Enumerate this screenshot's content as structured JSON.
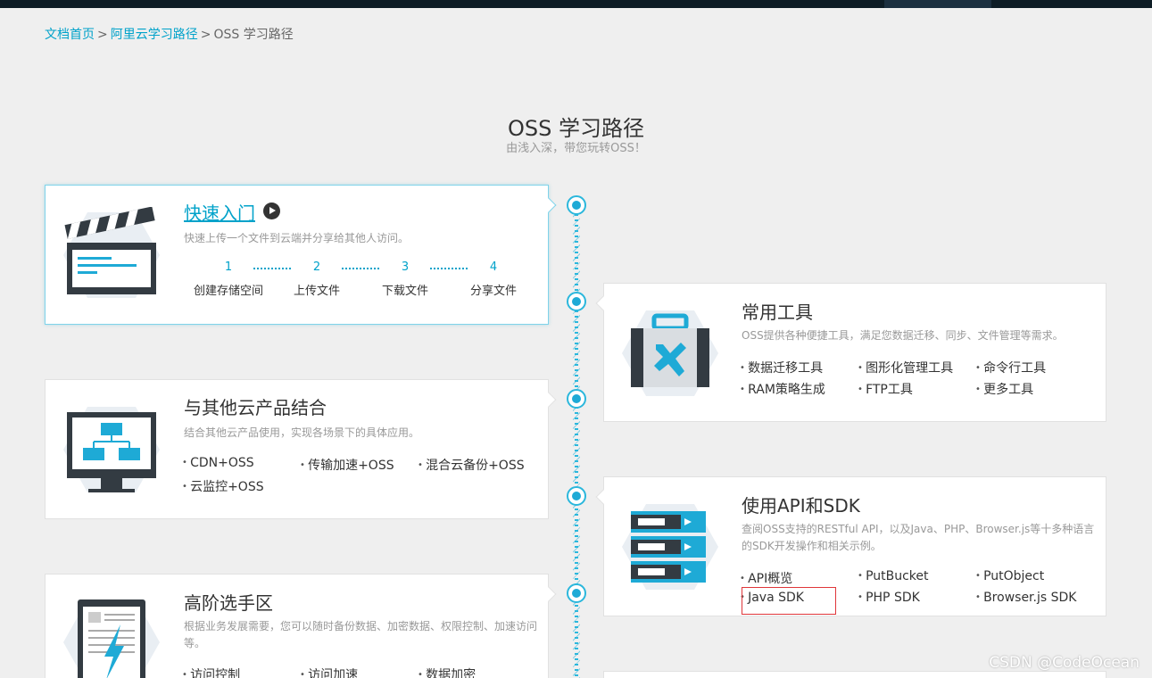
{
  "breadcrumb": {
    "home": "文档首页",
    "sep": ">",
    "path": "阿里云学习路径",
    "current": "OSS 学习路径"
  },
  "header": {
    "title": "OSS 学习路径",
    "subtitle": "由浅入深，带您玩转OSS！"
  },
  "cards": {
    "quickstart": {
      "title": "快速入门",
      "desc": "快速上传一个文件到云端并分享给其他人访问。",
      "steps": [
        {
          "num": "1",
          "label": "创建存储空间"
        },
        {
          "num": "2",
          "label": "上传文件"
        },
        {
          "num": "3",
          "label": "下载文件"
        },
        {
          "num": "4",
          "label": "分享文件"
        }
      ],
      "icon": "clapperboard-icon"
    },
    "tools": {
      "title": "常用工具",
      "desc": "OSS提供各种便捷工具，满足您数据迁移、同步、文件管理等需求。",
      "items": [
        "数据迁移工具",
        "图形化管理工具",
        "命令行工具",
        "RAM策略生成",
        "FTP工具",
        "更多工具"
      ],
      "icon": "toolbox-icon"
    },
    "integration": {
      "title": "与其他云产品结合",
      "desc": "结合其他云产品使用，实现各场景下的具体应用。",
      "items": [
        "CDN+OSS",
        "传输加速+OSS",
        "混合云备份+OSS",
        "云监控+OSS"
      ],
      "icon": "monitor-diagram-icon"
    },
    "api": {
      "title": "使用API和SDK",
      "desc": "查阅OSS支持的RESTful API，以及Java、PHP、Browser.js等十多种语言的SDK开发操作和相关示例。",
      "items": [
        "API概览",
        "PutBucket",
        "PutObject",
        "Java SDK",
        "PHP SDK",
        "Browser.js SDK"
      ],
      "icon": "server-stack-icon"
    },
    "advanced": {
      "title": "高阶选手区",
      "desc": "根据业务发展需要，您可以随时备份数据、加密数据、权限控制、加速访问等。",
      "items": [
        "访问控制",
        "访问加速",
        "数据加密"
      ],
      "icon": "tablet-lightning-icon"
    }
  },
  "colors": {
    "accent": "#00a2ca",
    "timeline": "#2bb7dc",
    "highlight": "#e0363a"
  },
  "watermark": "CSDN @CodeOcean"
}
